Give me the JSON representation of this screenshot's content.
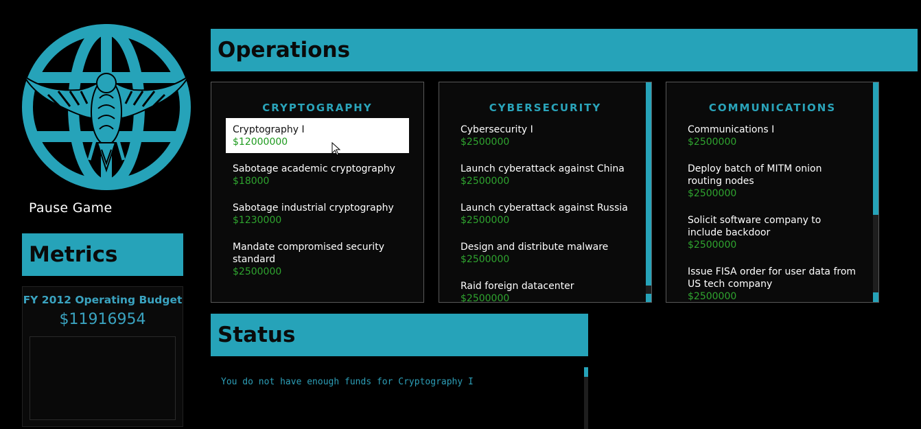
{
  "sidebar": {
    "pause_label": "Pause Game",
    "metrics_title": "Metrics",
    "budget_label": "FY 2012 Operating Budget",
    "budget_value": "$11916954"
  },
  "operations": {
    "title": "Operations",
    "panels": [
      {
        "title": "CRYPTOGRAPHY",
        "items": [
          {
            "name": "Cryptography I",
            "price": "$12000000",
            "selected": true
          },
          {
            "name": "Sabotage academic cryptography",
            "price": "$18000"
          },
          {
            "name": "Sabotage industrial cryptography",
            "price": "$1230000"
          },
          {
            "name": "Mandate compromised security standard",
            "price": "$2500000"
          }
        ]
      },
      {
        "title": "CYBERSECURITY",
        "items": [
          {
            "name": "Cybersecurity I",
            "price": "$2500000"
          },
          {
            "name": "Launch cyberattack against China",
            "price": "$2500000"
          },
          {
            "name": "Launch cyberattack against Russia",
            "price": "$2500000"
          },
          {
            "name": "Design and distribute malware",
            "price": "$2500000"
          },
          {
            "name": "Raid foreign datacenter",
            "price": "$2500000"
          }
        ]
      },
      {
        "title": "COMMUNICATIONS",
        "items": [
          {
            "name": "Communications I",
            "price": "$2500000"
          },
          {
            "name": "Deploy batch of MITM onion routing nodes",
            "price": "$2500000"
          },
          {
            "name": "Solicit software company to include backdoor",
            "price": "$2500000"
          },
          {
            "name": "Issue FISA order for user data from US tech company",
            "price": "$2500000"
          }
        ]
      }
    ]
  },
  "status": {
    "title": "Status",
    "message": "You do not have enough funds for Cryptography I"
  },
  "colors": {
    "accent": "#26a3b9",
    "price": "#2fa42f",
    "background": "#000000"
  },
  "icons": {
    "logo": "eagle-globe-emblem",
    "cursor": "mouse-pointer-icon"
  }
}
